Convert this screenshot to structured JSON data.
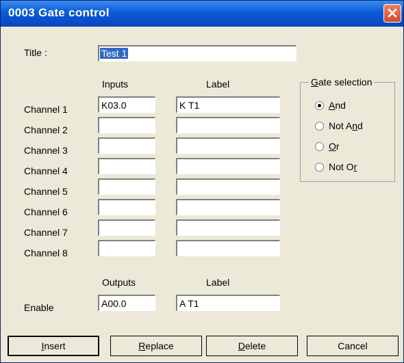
{
  "window": {
    "title": "0003  Gate control"
  },
  "title_field": {
    "label": "Title :",
    "value": "Test 1"
  },
  "columns": {
    "inputs": "Inputs",
    "label": "Label",
    "outputs": "Outputs",
    "output_label": "Label"
  },
  "channels": [
    {
      "name": "Channel 1",
      "input": "K03.0",
      "label": "K T1"
    },
    {
      "name": "Channel 2",
      "input": "",
      "label": ""
    },
    {
      "name": "Channel 3",
      "input": "",
      "label": ""
    },
    {
      "name": "Channel 4",
      "input": "",
      "label": ""
    },
    {
      "name": "Channel 5",
      "input": "",
      "label": ""
    },
    {
      "name": "Channel 6",
      "input": "",
      "label": ""
    },
    {
      "name": "Channel 7",
      "input": "",
      "label": ""
    },
    {
      "name": "Channel 8",
      "input": "",
      "label": ""
    }
  ],
  "enable": {
    "name": "Enable",
    "output": "A00.0",
    "label": "A T1"
  },
  "gate_selection": {
    "legend_first": "G",
    "legend_rest": "ate selection",
    "options": [
      {
        "pre": "",
        "key": "A",
        "post": "nd",
        "selected": true
      },
      {
        "pre": "Not A",
        "key": "n",
        "post": "d",
        "selected": false
      },
      {
        "pre": "",
        "key": "O",
        "post": "r",
        "selected": false
      },
      {
        "pre": "Not O",
        "key": "r",
        "post": "",
        "selected": false
      }
    ]
  },
  "buttons": {
    "insert": {
      "key": "I",
      "rest": "nsert"
    },
    "replace": {
      "key": "R",
      "rest": "eplace"
    },
    "delete": {
      "key": "D",
      "rest": "elete"
    },
    "cancel": {
      "label": "Cancel"
    }
  },
  "colors": {
    "titlebar": "#0a5ad8",
    "selection": "#316ac5",
    "face": "#ece9d8"
  }
}
